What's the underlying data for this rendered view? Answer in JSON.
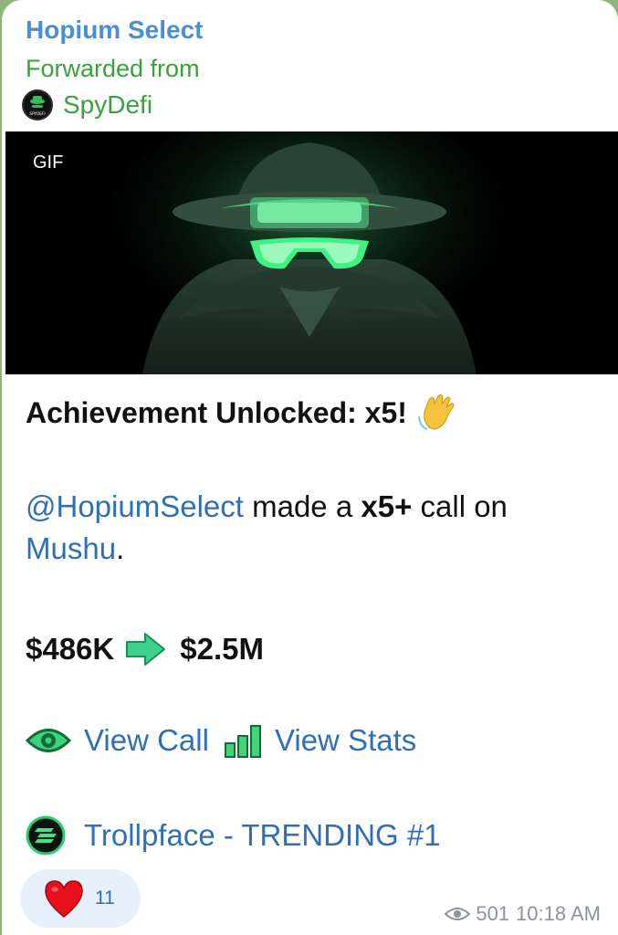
{
  "message": {
    "sender": "Hopium Select",
    "forwarded_label": "Forwarded from",
    "source": {
      "name": "SpyDefi",
      "avatar_text": "SPYDEFI",
      "avatar_icon": "spy-icon"
    },
    "media": {
      "badge": "GIF",
      "subject": "spy-hat-glasses-icon"
    },
    "title": {
      "text": "Achievement Unlocked: x5!",
      "emoji": "waving-hand-icon"
    },
    "body": {
      "mention": "@HopiumSelect",
      "text1": "made a",
      "multiplier": "x5+",
      "text2": "call on",
      "token": "Mushu",
      "period": "."
    },
    "price": {
      "from": "$486K",
      "arrow": "right-arrow-icon",
      "to": "$2.5M"
    },
    "actions": {
      "view_call": "View Call",
      "view_stats": "View Stats"
    },
    "trending": {
      "text": "Trollpface - TRENDING #1",
      "icon": "solana-icon"
    },
    "reaction": {
      "emoji": "heart-icon",
      "count": "11"
    },
    "views": "501",
    "time": "10:18 AM"
  },
  "colors": {
    "sender": "#4a8fd4",
    "forwarded": "#3aa23a",
    "link": "#2f6fb8",
    "background": "#8fb57a",
    "accent_green": "#35c96a"
  }
}
